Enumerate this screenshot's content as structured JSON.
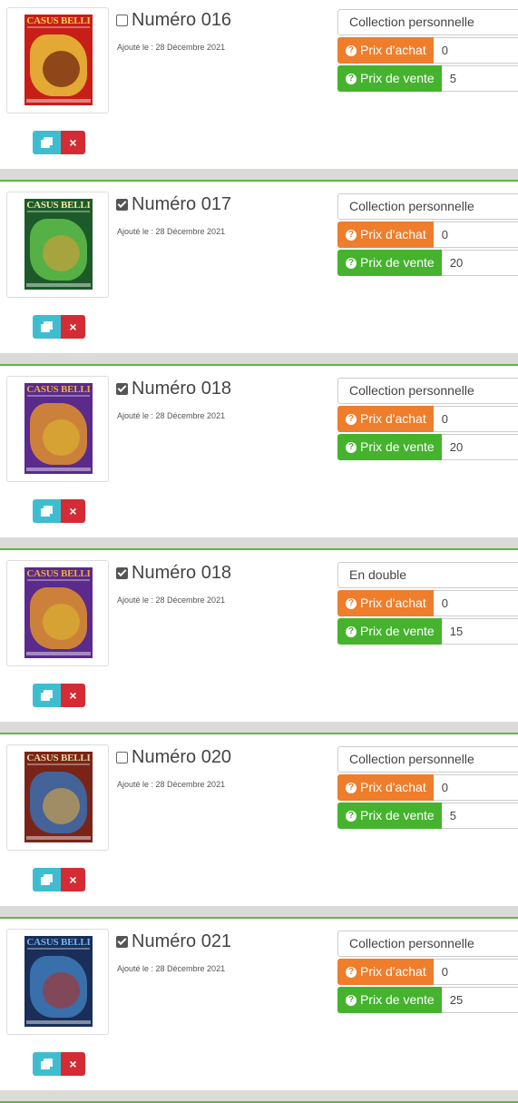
{
  "labels": {
    "added_prefix": "Ajouté le : ",
    "buy_label": "Prix d'achat",
    "sell_label": "Prix de vente",
    "help_icon": "?",
    "delete_icon": "×"
  },
  "colors": {
    "buy": "#ee7d2c",
    "sell": "#45b32d",
    "copy_button": "#3fbdd0",
    "delete_button": "#d42c34",
    "separator_green": "#5cb83a"
  },
  "items": [
    {
      "title": "Numéro 016",
      "checked": false,
      "added": "Ajouté le : 28 Décembre 2021",
      "status": "Collection personnelle",
      "buy_price": "0",
      "sell_price": "5",
      "cover": {
        "logo": "CASUS BELLI",
        "bg": "#c81e18",
        "art": "#e8c23a",
        "art2": "#6b1d0e",
        "logo_color": "#f5d04a"
      }
    },
    {
      "title": "Numéro 017",
      "checked": true,
      "added": "Ajouté le : 28 Décembre 2021",
      "status": "Collection personnelle",
      "buy_price": "0",
      "sell_price": "20",
      "cover": {
        "logo": "CASUS BELLI",
        "bg": "#1d5a2a",
        "art": "#5fbf4a",
        "art2": "#c9a03c",
        "logo_color": "#f2e7a0"
      }
    },
    {
      "title": "Numéro 018",
      "checked": true,
      "added": "Ajouté le : 28 Décembre 2021",
      "status": "Collection personnelle",
      "buy_price": "0",
      "sell_price": "20",
      "cover": {
        "logo": "CASUS BELLI",
        "bg": "#5a2a8c",
        "art": "#e0902c",
        "art2": "#d8b030",
        "logo_color": "#f0b030"
      }
    },
    {
      "title": "Numéro 018",
      "checked": true,
      "added": "Ajouté le : 28 Décembre 2021",
      "status": "En double",
      "buy_price": "0",
      "sell_price": "15",
      "cover": {
        "logo": "CASUS BELLI",
        "bg": "#5a2a8c",
        "art": "#e0902c",
        "art2": "#d8b030",
        "logo_color": "#f0b030"
      }
    },
    {
      "title": "Numéro 020",
      "checked": false,
      "added": "Ajouté le : 28 Décembre 2021",
      "status": "Collection personnelle",
      "buy_price": "0",
      "sell_price": "5",
      "cover": {
        "logo": "CASUS BELLI",
        "bg": "#7a2418",
        "art": "#3a6fb0",
        "art2": "#c8a050",
        "logo_color": "#e8d8a0"
      }
    },
    {
      "title": "Numéro 021",
      "checked": true,
      "added": "Ajouté le : 28 Décembre 2021",
      "status": "Collection personnelle",
      "buy_price": "0",
      "sell_price": "25",
      "cover": {
        "logo": "CASUS BELLI",
        "bg": "#1a2e5a",
        "art": "#3f7ab8",
        "art2": "#a03838",
        "logo_color": "#70b8e8"
      }
    }
  ]
}
